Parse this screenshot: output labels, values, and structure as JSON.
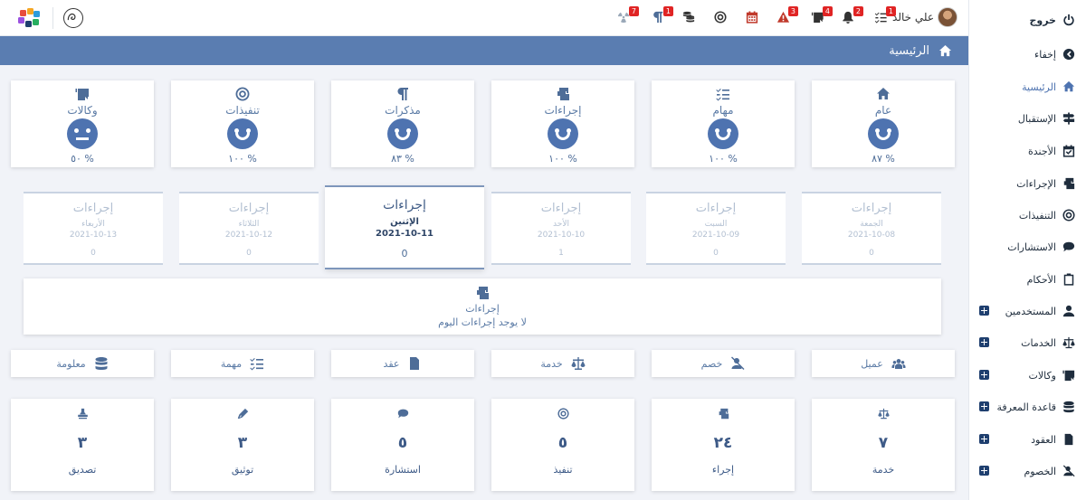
{
  "user": {
    "name": "علي خالد"
  },
  "topbar_badges": {
    "tasks": "1",
    "notifications": "2",
    "agencies": "4",
    "alerts": "3",
    "procedures": "1",
    "paragraphs": "1",
    "radiation": "7"
  },
  "sidebar": {
    "items": [
      {
        "label": "خروج",
        "icon": "power-icon"
      },
      {
        "label": "إخفاء",
        "icon": "chevron-circle-left-icon"
      },
      {
        "label": "الرئيسية",
        "icon": "home-icon"
      },
      {
        "label": "الإستقبال",
        "icon": "signpost-icon"
      },
      {
        "label": "الأجندة",
        "icon": "calendar-check-icon"
      },
      {
        "label": "الإجراءات",
        "icon": "mail-bulk-icon"
      },
      {
        "label": "التنفيذات",
        "icon": "bullseye-icon"
      },
      {
        "label": "الاستشارات",
        "icon": "comment-icon"
      },
      {
        "label": "الأحكام",
        "icon": "clipboard-icon"
      },
      {
        "label": "المستخدمين",
        "icon": "user-icon"
      },
      {
        "label": "الخدمات",
        "icon": "scale-icon"
      },
      {
        "label": "وكالات",
        "icon": "id-card-icon"
      },
      {
        "label": "قاعدة المعرفة",
        "icon": "database-icon"
      },
      {
        "label": "العقود",
        "icon": "file-contract-icon"
      },
      {
        "label": "الخصوم",
        "icon": "user-slash-icon"
      }
    ]
  },
  "header": {
    "title": "الرئيسية"
  },
  "summary_cards": [
    {
      "label": "عام",
      "pct": "٨٧ %",
      "icon": "home-icon",
      "mood": "happy"
    },
    {
      "label": "مهام",
      "pct": "١٠٠ %",
      "icon": "tasks-icon",
      "mood": "happy"
    },
    {
      "label": "إجراءات",
      "pct": "١٠٠ %",
      "icon": "mail-bulk-icon",
      "mood": "happy"
    },
    {
      "label": "مذكرات",
      "pct": "٨٣ %",
      "icon": "paragraph-icon",
      "mood": "happy"
    },
    {
      "label": "تنفيذات",
      "pct": "١٠٠ %",
      "icon": "bullseye-icon",
      "mood": "happy"
    },
    {
      "label": "وكالات",
      "pct": "٥٠ %",
      "icon": "id-card-icon",
      "mood": "neutral"
    }
  ],
  "days": [
    {
      "title": "إجراءات",
      "weekday": "الجمعة",
      "date": "2021-10-08",
      "count": "0"
    },
    {
      "title": "إجراءات",
      "weekday": "السبت",
      "date": "2021-10-09",
      "count": "0"
    },
    {
      "title": "إجراءات",
      "weekday": "الأحد",
      "date": "2021-10-10",
      "count": "1"
    },
    {
      "title": "إجراءات",
      "weekday": "الإثنين",
      "date": "2021-10-11",
      "count": "0"
    },
    {
      "title": "إجراءات",
      "weekday": "الثلاثاء",
      "date": "2021-10-12",
      "count": "0"
    },
    {
      "title": "إجراءات",
      "weekday": "الأربعاء",
      "date": "2021-10-13",
      "count": "0"
    }
  ],
  "today": {
    "title": "إجراءات",
    "message": "لا يوجد إجراءات اليوم"
  },
  "quick_add": [
    {
      "label": "عميل",
      "icon": "users-icon"
    },
    {
      "label": "خصم",
      "icon": "user-slash-icon"
    },
    {
      "label": "خدمة",
      "icon": "scale-icon"
    },
    {
      "label": "عقد",
      "icon": "file-contract-icon"
    },
    {
      "label": "مهمة",
      "icon": "tasks-icon"
    },
    {
      "label": "معلومة",
      "icon": "database-icon"
    }
  ],
  "stats": [
    {
      "label": "خدمة",
      "value": "٧",
      "icon": "scale-icon"
    },
    {
      "label": "إجراء",
      "value": "٢٤",
      "icon": "mail-bulk-icon"
    },
    {
      "label": "تنفيذ",
      "value": "٥",
      "icon": "bullseye-icon"
    },
    {
      "label": "استشارة",
      "value": "٥",
      "icon": "comment-icon"
    },
    {
      "label": "توثيق",
      "value": "٣",
      "icon": "pen-icon"
    },
    {
      "label": "تصديق",
      "value": "٣",
      "icon": "stamp-icon"
    }
  ]
}
